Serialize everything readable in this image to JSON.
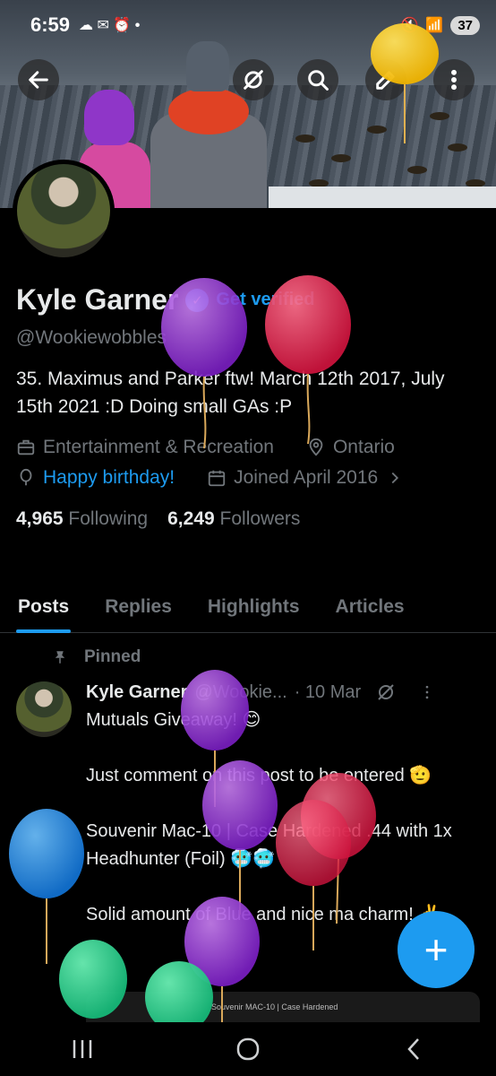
{
  "status_bar": {
    "time": "6:59",
    "battery": "37"
  },
  "header": {
    "buttons": [
      "back",
      "grok",
      "search",
      "edit",
      "more"
    ]
  },
  "profile": {
    "name": "Kyle Garner",
    "verify_label": "Get verified",
    "handle": "@Wookiewobbles",
    "bio": "35. Maximus and Parker ftw! March 12th 2017, July 15th 2021 :D Doing small GAs :P",
    "category": "Entertainment & Recreation",
    "location": "Ontario",
    "birthday": "Happy birthday!",
    "joined": "Joined April 2016",
    "following_count": "4,965",
    "following_label": "Following",
    "followers_count": "6,249",
    "followers_label": "Followers"
  },
  "tabs": [
    "Posts",
    "Replies",
    "Highlights",
    "Articles"
  ],
  "pinned_post": {
    "pinned_label": "Pinned",
    "author": "Kyle Garner",
    "handle": "@Wookie...",
    "date": "· 10 Mar",
    "text": "Mutuals Giveaway! 😊\n\nJust comment on this post to be entered 🫡\n\nSouvenir Mac-10 | Case Hardened .44 with 1x Headhunter (Foil) 🥶🥶\n\nSolid amount of Blue and nice ma charm! ✌️",
    "media_caption": "Souvenir MAC-10 | Case Hardened"
  },
  "colors": {
    "accent": "#1d9bf0",
    "background": "#000000",
    "muted": "#71767b"
  }
}
